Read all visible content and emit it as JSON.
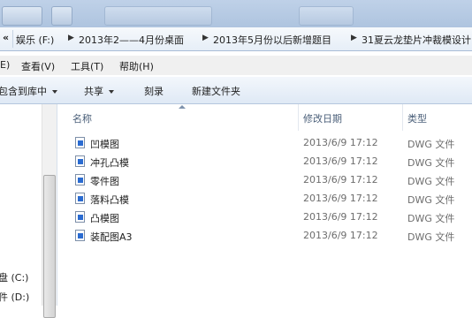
{
  "address": {
    "nav_glyph": "«",
    "sep_glyph": "▶",
    "crumbs": [
      "娱乐 (F:)",
      "2013年2——4月份桌面",
      "2013年5月份以后新增题目",
      "31夏云龙垫片冲裁模设计"
    ]
  },
  "menu": {
    "items": [
      "E)",
      "查看(V)",
      "工具(T)",
      "帮助(H)"
    ]
  },
  "toolbar": {
    "include_label": "包含到库中",
    "share_label": "共享",
    "burn_label": "刻录",
    "new_folder_label": "新建文件夹"
  },
  "nav": {
    "drives": [
      "盘 (C:)",
      "件 (D:)"
    ]
  },
  "columns": {
    "name": "名称",
    "date": "修改日期",
    "type": "类型"
  },
  "files": [
    {
      "name": "凹模图",
      "date": "2013/6/9 17:12",
      "type": "DWG 文件"
    },
    {
      "name": "冲孔凸模",
      "date": "2013/6/9 17:12",
      "type": "DWG 文件"
    },
    {
      "name": "零件图",
      "date": "2013/6/9 17:12",
      "type": "DWG 文件"
    },
    {
      "name": "落料凸模",
      "date": "2013/6/9 17:12",
      "type": "DWG 文件"
    },
    {
      "name": "凸模图",
      "date": "2013/6/9 17:12",
      "type": "DWG 文件"
    },
    {
      "name": "装配图A3",
      "date": "2013/6/9 17:12",
      "type": "DWG 文件"
    }
  ],
  "colors": {
    "file_icon_accent": "#2a6bd1",
    "header_text": "#4c607a",
    "secondary_text": "#6d6d6d"
  }
}
